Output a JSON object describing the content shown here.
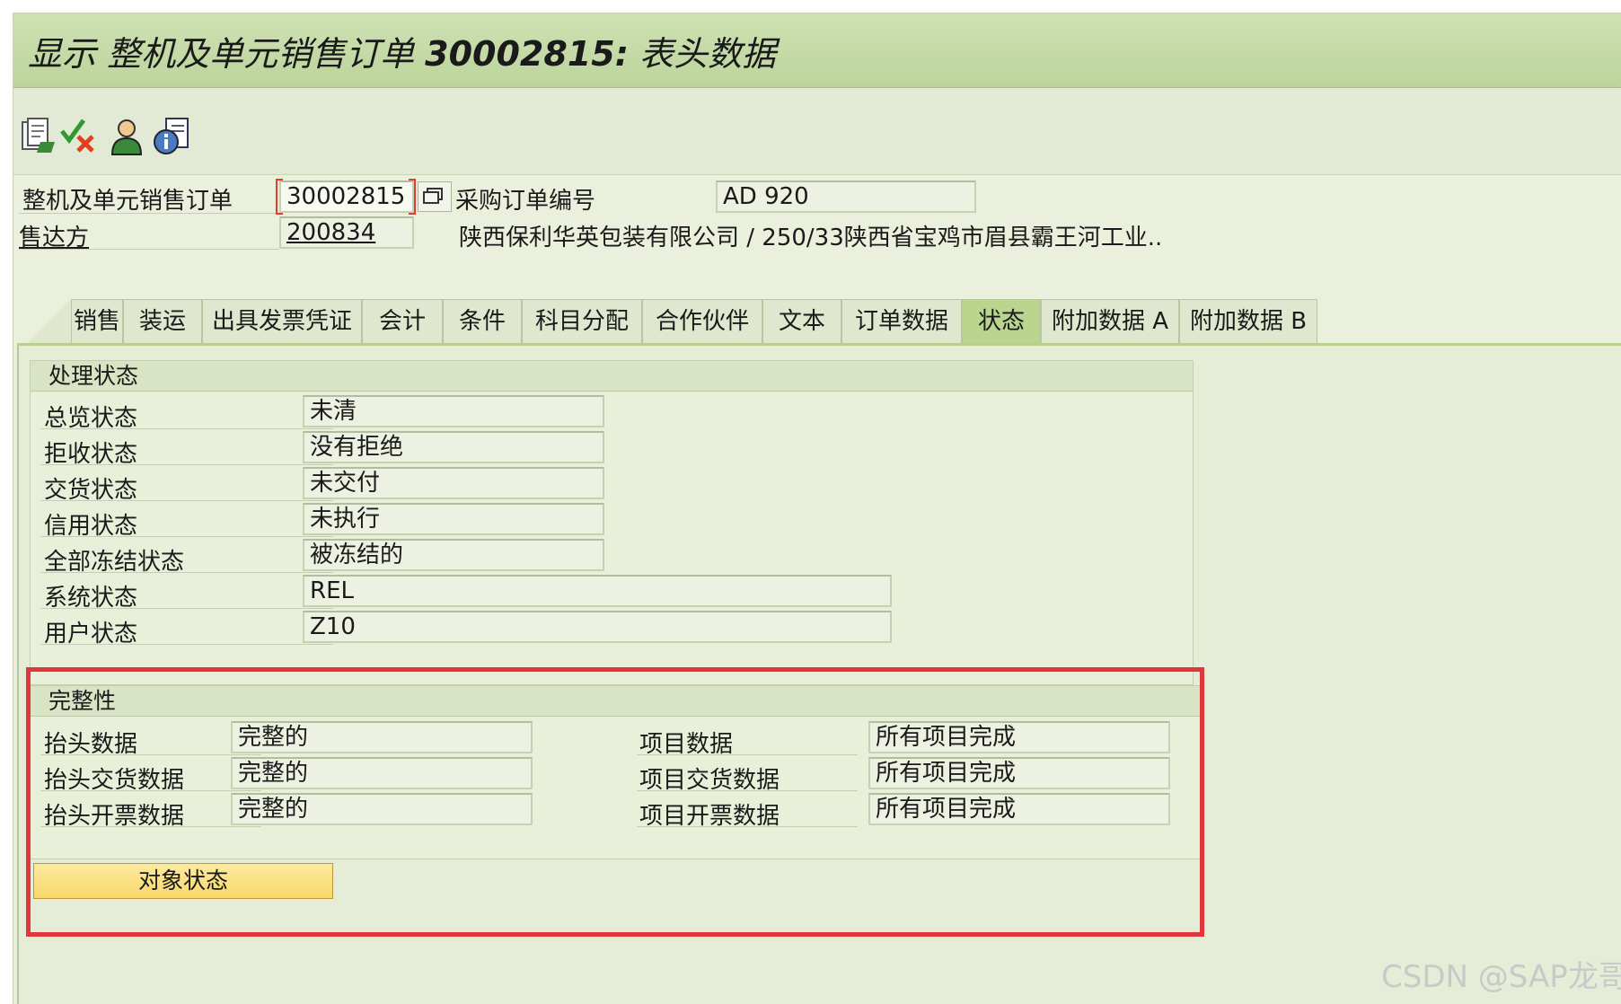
{
  "window": {
    "title_prefix": "显示 整机及单元销售订单 ",
    "title_number": "30002815:",
    "title_suffix": " 表头数据"
  },
  "toolbar": {
    "buttons": [
      {
        "icon": "document-display-icon"
      },
      {
        "icon": "check-cancel-icon"
      },
      {
        "icon": "person-icon"
      },
      {
        "icon": "info-document-icon"
      }
    ]
  },
  "header": {
    "order_label": "整机及单元销售订单",
    "order_value": "30002815",
    "po_label": "采购订单编号",
    "po_value": "AD 920",
    "soldto_label": "售达方",
    "soldto_value": "200834",
    "soldto_desc": "陕西保利华英包装有限公司 / 250/33陕西省宝鸡市眉县霸王河工业.."
  },
  "tabs": [
    {
      "label": "销售",
      "active": false
    },
    {
      "label": "装运",
      "active": false
    },
    {
      "label": "出具发票凭证",
      "active": false
    },
    {
      "label": "会计",
      "active": false
    },
    {
      "label": "条件",
      "active": false
    },
    {
      "label": "科目分配",
      "active": false
    },
    {
      "label": "合作伙伴",
      "active": false
    },
    {
      "label": "文本",
      "active": false
    },
    {
      "label": "订单数据",
      "active": false
    },
    {
      "label": "状态",
      "active": true
    },
    {
      "label": "附加数据 A",
      "active": false
    },
    {
      "label": "附加数据 B",
      "active": false
    }
  ],
  "processing": {
    "title": "处理状态",
    "rows": [
      {
        "label": "总览状态",
        "value": "未清"
      },
      {
        "label": "拒收状态",
        "value": "没有拒绝"
      },
      {
        "label": "交货状态",
        "value": "未交付"
      },
      {
        "label": "信用状态",
        "value": "未执行"
      },
      {
        "label": "全部冻结状态",
        "value": "被冻结的"
      },
      {
        "label": "系统状态",
        "value": "REL"
      },
      {
        "label": "用户状态",
        "value": "Z10"
      }
    ]
  },
  "completeness": {
    "title": "完整性",
    "left": [
      {
        "label": "抬头数据",
        "value": "完整的"
      },
      {
        "label": "抬头交货数据",
        "value": "完整的"
      },
      {
        "label": "抬头开票数据",
        "value": "完整的"
      }
    ],
    "right": [
      {
        "label": "项目数据",
        "value": "所有项目完成"
      },
      {
        "label": "项目交货数据",
        "value": "所有项目完成"
      },
      {
        "label": "项目开票数据",
        "value": "所有项目完成"
      }
    ],
    "button_label": "对象状态"
  },
  "watermark": "CSDN @SAP龙哥",
  "colors": {
    "titlebar": "#bcd49b",
    "active_tab": "#b9d58e",
    "highlight_box": "#e2373a",
    "object_button": "#f9d86a"
  }
}
